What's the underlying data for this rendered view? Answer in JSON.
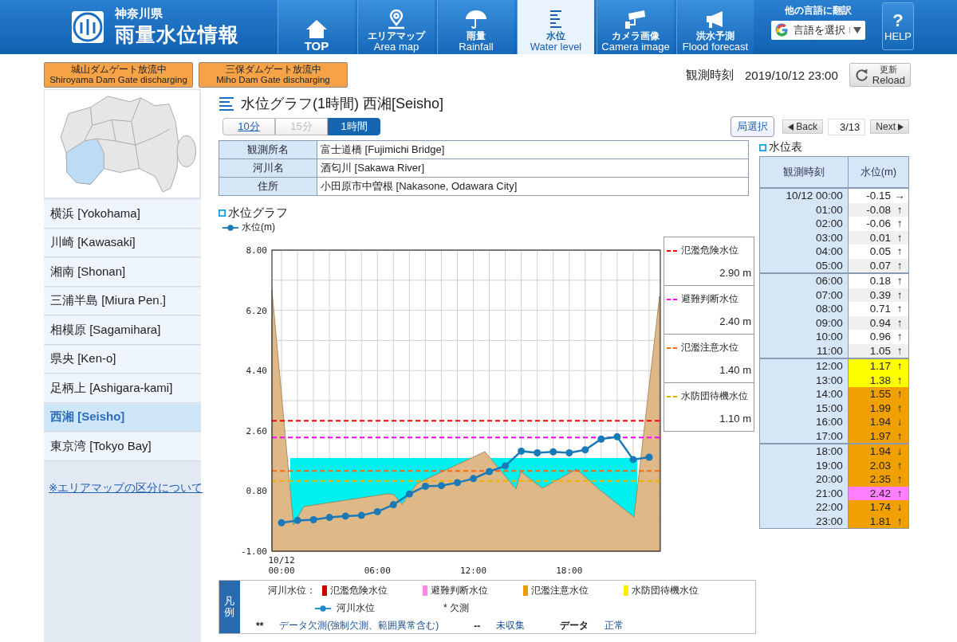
{
  "header": {
    "prefecture": "神奈川県",
    "title": "雨量水位情報",
    "nav": [
      {
        "label": "TOP",
        "selected": false
      },
      {
        "label": "エリアマップ",
        "label_en": "Area map",
        "selected": false
      },
      {
        "label": "雨量",
        "label_en": "Rainfall",
        "selected": false
      },
      {
        "label": "水位",
        "label_en": "Water level",
        "selected": true
      },
      {
        "label": "カメラ画像",
        "label_en": "Camera image",
        "selected": false
      },
      {
        "label": "洪水予測",
        "label_en": "Flood forecast",
        "selected": false
      }
    ],
    "translate": {
      "title": "他の言語に翻訳",
      "select": "言語を選択"
    },
    "help": {
      "mark": "?",
      "label": "HELP"
    }
  },
  "dam_notices": [
    {
      "ja": "城山ダムゲート放流中",
      "en": "Shiroyama Dam Gate discharging"
    },
    {
      "ja": "三保ダムゲート放流中",
      "en": "Miho Dam Gate discharging"
    }
  ],
  "observed": {
    "label": "観測時刻",
    "time": "2019/10/12 23:00"
  },
  "reload": {
    "ja": "更新",
    "en": "Reload"
  },
  "sidebar": {
    "items": [
      {
        "label": "横浜 [Yokohama]",
        "selected": false
      },
      {
        "label": "川崎 [Kawasaki]",
        "selected": false
      },
      {
        "label": "湘南 [Shonan]",
        "selected": false
      },
      {
        "label": "三浦半島 [Miura Pen.]",
        "selected": false
      },
      {
        "label": "相模原 [Sagamihara]",
        "selected": false
      },
      {
        "label": "県央 [Ken-o]",
        "selected": false
      },
      {
        "label": "足柄上 [Ashigara-kami]",
        "selected": false
      },
      {
        "label": "西湘 [Seisho]",
        "selected": true
      },
      {
        "label": "東京湾 [Tokyo Bay]",
        "selected": false
      }
    ],
    "link": "※エリアマップの区分について"
  },
  "page_title": "水位グラフ(1時間) 西湘[Seisho]",
  "intervals": [
    {
      "label": "10分",
      "selected": false,
      "disabled": false
    },
    {
      "label": "15分",
      "selected": false,
      "disabled": true
    },
    {
      "label": "1時間",
      "selected": true,
      "disabled": false
    }
  ],
  "station_select": "局選択",
  "pager": {
    "back": "Back",
    "position": "3/13",
    "next": "Next"
  },
  "info": [
    {
      "label": "観測所名",
      "value": "富士道橋 [Fujimichi Bridge]"
    },
    {
      "label": "河川名",
      "value": "酒匂川 [Sakawa River]"
    },
    {
      "label": "住所",
      "value": "小田原市中曽根 [Nakasone, Odawara City]"
    }
  ],
  "graph": {
    "heading": "水位グラフ",
    "x_date_label": "10/12",
    "chart_data": {
      "type": "line",
      "grid": true,
      "x": [
        0,
        1,
        2,
        3,
        4,
        5,
        6,
        7,
        8,
        9,
        10,
        11,
        12,
        13,
        14,
        15,
        16,
        17,
        18,
        19,
        20,
        21,
        22,
        23
      ],
      "xlim": [
        -0.6,
        23.7
      ],
      "ylim": [
        -1,
        8
      ],
      "xticks": [
        {
          "value": 0,
          "label": "00:00"
        },
        {
          "value": 6,
          "label": "06:00"
        },
        {
          "value": 12,
          "label": "12:00"
        },
        {
          "value": 18,
          "label": "18:00"
        }
      ],
      "yticks": [
        {
          "value": -1,
          "label": "-1.00"
        },
        {
          "value": 0.8,
          "label": "0.80"
        },
        {
          "value": 2.6,
          "label": "2.60"
        },
        {
          "value": 4.4,
          "label": "4.40"
        },
        {
          "value": 6.2,
          "label": "6.20"
        },
        {
          "value": 8,
          "label": "8.00"
        }
      ],
      "series": [
        {
          "name": "水位(m)",
          "color": "#1a7ab8",
          "marker": "circle",
          "values": [
            -0.15,
            -0.08,
            -0.06,
            0.01,
            0.05,
            0.07,
            0.18,
            0.39,
            0.71,
            0.94,
            0.96,
            1.05,
            1.17,
            1.38,
            1.55,
            1.99,
            1.94,
            1.97,
            1.94,
            2.03,
            2.35,
            2.42,
            1.74,
            1.81
          ]
        }
      ],
      "ref_lines": [
        {
          "axis": "y",
          "value": 2.9,
          "color": "#ff0000"
        },
        {
          "axis": "y",
          "value": 2.4,
          "color": "#ff00ff"
        },
        {
          "axis": "y",
          "value": 1.4,
          "color": "#ff6600"
        },
        {
          "axis": "y",
          "value": 1.1,
          "color": "#f0b000"
        }
      ]
    },
    "threshold_legend": [
      {
        "label": "氾濫危険水位",
        "reading": "2.90 m",
        "color": "#ff0000"
      },
      {
        "label": "避難判断水位",
        "reading": "2.40 m",
        "color": "#ff00ff"
      },
      {
        "label": "氾濫注意水位",
        "reading": "1.40 m",
        "color": "#ff6600"
      },
      {
        "label": "水防団待機水位",
        "reading": "1.10 m",
        "color": "#f0b000"
      }
    ]
  },
  "table": {
    "heading": "水位表",
    "columns": [
      "観測時刻",
      "水位(m)"
    ],
    "rows": [
      {
        "time": "10/12 00:00",
        "value": "-0.15",
        "trend": "→"
      },
      {
        "time": "01:00",
        "value": "-0.08",
        "trend": "↑"
      },
      {
        "time": "02:00",
        "value": "-0.06",
        "trend": "↑"
      },
      {
        "time": "03:00",
        "value": "0.01",
        "trend": "↑"
      },
      {
        "time": "04:00",
        "value": "0.05",
        "trend": "↑"
      },
      {
        "time": "05:00",
        "value": "0.07",
        "trend": "↑"
      },
      {
        "time": "06:00",
        "value": "0.18",
        "trend": "↑"
      },
      {
        "time": "07:00",
        "value": "0.39",
        "trend": "↑"
      },
      {
        "time": "08:00",
        "value": "0.71",
        "trend": "↑"
      },
      {
        "time": "09:00",
        "value": "0.94",
        "trend": "↑"
      },
      {
        "time": "10:00",
        "value": "0.96",
        "trend": "↑"
      },
      {
        "time": "11:00",
        "value": "1.05",
        "trend": "↑"
      },
      {
        "time": "12:00",
        "value": "1.17",
        "trend": "↑",
        "color": "#ffff00"
      },
      {
        "time": "13:00",
        "value": "1.38",
        "trend": "↑",
        "color": "#ffff00"
      },
      {
        "time": "14:00",
        "value": "1.55",
        "trend": "↑",
        "color": "#f0a000"
      },
      {
        "time": "15:00",
        "value": "1.99",
        "trend": "↑",
        "color": "#f0a000"
      },
      {
        "time": "16:00",
        "value": "1.94",
        "trend": "↓",
        "color": "#f0a000"
      },
      {
        "time": "17:00",
        "value": "1.97",
        "trend": "↑",
        "color": "#f0a000"
      },
      {
        "time": "18:00",
        "value": "1.94",
        "trend": "↓",
        "color": "#f0a000"
      },
      {
        "time": "19:00",
        "value": "2.03",
        "trend": "↑",
        "color": "#f0a000"
      },
      {
        "time": "20:00",
        "value": "2.35",
        "trend": "↑",
        "color": "#f0a000"
      },
      {
        "time": "21:00",
        "value": "2.42",
        "trend": "↑",
        "color": "#ff80ff"
      },
      {
        "time": "22:00",
        "value": "1.74",
        "trend": "↓",
        "color": "#f0a000"
      },
      {
        "time": "23:00",
        "value": "1.81",
        "trend": "↑",
        "color": "#f0a000"
      }
    ]
  },
  "legend": {
    "title": "凡例",
    "river_label": "河川水位：",
    "swatches": [
      {
        "label": "氾濫危険水位",
        "color": "#cc0000"
      },
      {
        "label": "避難判断水位",
        "color": "#ff88ee"
      },
      {
        "label": "氾濫注意水位",
        "color": "#ee9900"
      },
      {
        "label": "水防団待機水位",
        "color": "#ffee00"
      }
    ],
    "line_label": "河川水位",
    "missing": "* 欠測",
    "notes": [
      {
        "mark": "**",
        "label": "データ欠測(強制欠測、範囲異常含む)"
      },
      {
        "mark": "--",
        "label": "未収集"
      },
      {
        "mark": "データ",
        "label": "正常"
      }
    ]
  }
}
